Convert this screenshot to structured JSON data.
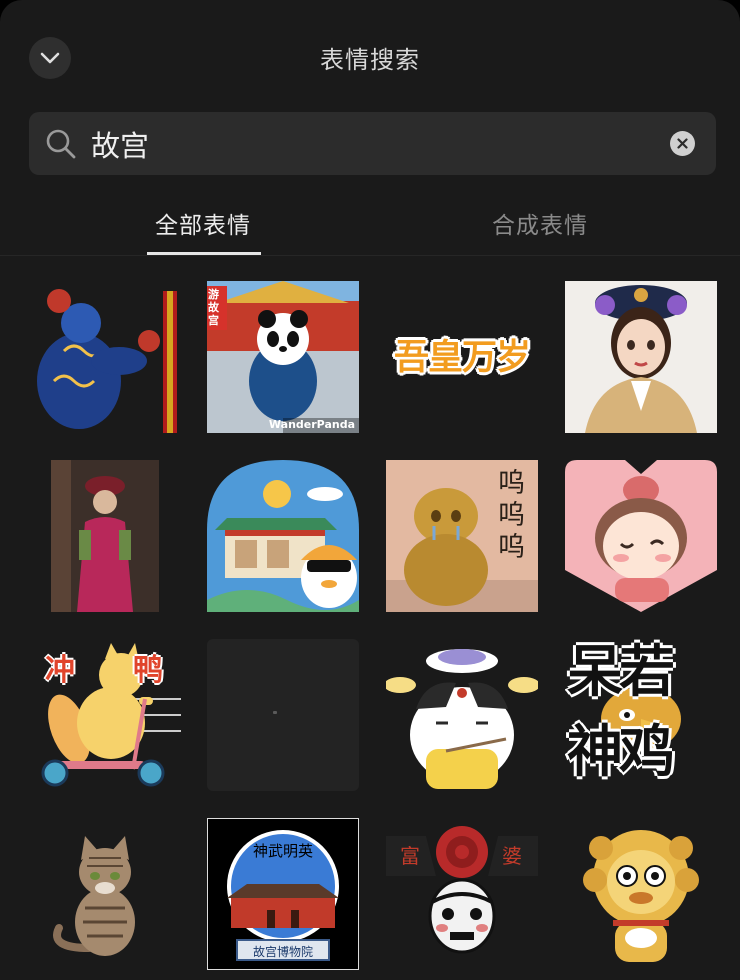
{
  "header": {
    "title": "表情搜索",
    "back_icon": "chevron-down-icon"
  },
  "search": {
    "value": "故宫",
    "icon": "search-icon",
    "clear_icon": "close-icon"
  },
  "tabs": [
    {
      "label": "全部表情",
      "active": true
    },
    {
      "label": "合成表情",
      "active": false
    }
  ],
  "stickers": [
    {
      "name": "lion-guardian-sticker"
    },
    {
      "name": "panda-palace-sticker",
      "badge": "游故宫",
      "watermark": "WanderPanda"
    },
    {
      "name": "wu-huang-wansui-sticker",
      "text": "吾皇万岁"
    },
    {
      "name": "qing-princess-sticker"
    },
    {
      "name": "costume-person-photo-sticker"
    },
    {
      "name": "palace-duck-sunglasses-sticker"
    },
    {
      "name": "crying-lion-statue-sticker",
      "text": "呜呜呜"
    },
    {
      "name": "cute-princess-pink-sticker"
    },
    {
      "name": "cat-scooter-sticker",
      "left_text": "冲",
      "right_text": "鸭"
    },
    {
      "name": "blank-dark-sticker"
    },
    {
      "name": "cat-dinner-sticker"
    },
    {
      "name": "daruo-shenji-sticker",
      "line1": "呆若",
      "line2": "神鸡"
    },
    {
      "name": "tabby-cat-sticker"
    },
    {
      "name": "shenwu-gate-sticker",
      "top_text": "神武明英",
      "bottom_text": "故宫博物院"
    },
    {
      "name": "rich-lady-rose-sticker",
      "left_text": "富",
      "right_text": "婆"
    },
    {
      "name": "golden-lion-cartoon-sticker"
    }
  ],
  "colors": {
    "background": "#1a1a1a",
    "search_bg": "#2c2c2c",
    "active_tab": "#ededed",
    "inactive_tab": "#8a8a8a"
  }
}
